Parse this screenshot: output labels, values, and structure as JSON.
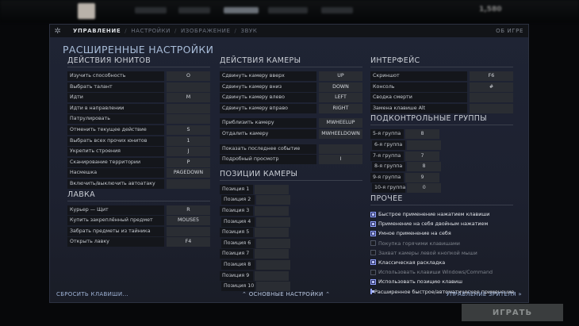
{
  "top": {
    "gold": "1,580"
  },
  "nav": {
    "items": [
      "УПРАВЛЕНИЕ",
      "НАСТРОЙКИ",
      "ИЗОБРАЖЕНИЕ",
      "ЗВУК"
    ],
    "about": "ОБ ИГРЕ"
  },
  "title": "РАСШИРЕННЫЕ НАСТРОЙКИ",
  "unit_actions": {
    "heading": "ДЕЙСТВИЯ ЮНИТОВ",
    "rows": [
      {
        "label": "Изучить способность",
        "key": "O"
      },
      {
        "label": "Выбрать талант",
        "key": ""
      },
      {
        "label": "Идти",
        "key": "M"
      },
      {
        "label": "Идти в направлении",
        "key": ""
      },
      {
        "label": "Патрулировать",
        "key": ""
      },
      {
        "label": "Отменить текущее действие",
        "key": "S"
      },
      {
        "label": "Выбрать всех прочих юнитов",
        "key": "1"
      },
      {
        "label": "Укрепить строения",
        "key": "J"
      },
      {
        "label": "Сканирование территории",
        "key": "P"
      },
      {
        "label": "Насмешка",
        "key": "PAGEDOWN"
      },
      {
        "label": "Включить/выключить автоатаку",
        "key": ""
      }
    ]
  },
  "shop": {
    "heading": "ЛАВКА",
    "rows": [
      {
        "label": "Курьер — Щит",
        "key": "R"
      },
      {
        "label": "Купить закреплённый предмет",
        "key": "MOUSE5"
      },
      {
        "label": "Забрать предметы из тайника",
        "key": ""
      },
      {
        "label": "Открыть лавку",
        "key": "F4"
      }
    ]
  },
  "camera_actions": {
    "heading": "ДЕЙСТВИЯ КАМЕРЫ",
    "groups": [
      [
        {
          "label": "Сдвинуть камеру вверх",
          "key": "UP"
        },
        {
          "label": "Сдвинуть камеру вниз",
          "key": "DOWN"
        },
        {
          "label": "Сдвинуть камеру влево",
          "key": "LEFT"
        },
        {
          "label": "Сдвинуть камеру вправо",
          "key": "RIGHT"
        }
      ],
      [
        {
          "label": "Приблизить камеру",
          "key": "MWHEELUP"
        },
        {
          "label": "Отдалить камеру",
          "key": "MWHEELDOWN"
        }
      ],
      [
        {
          "label": "Показать последнее событие",
          "key": ""
        },
        {
          "label": "Подробный просмотр",
          "key": "I"
        }
      ]
    ]
  },
  "camera_positions": {
    "heading": "ПОЗИЦИИ КАМЕРЫ",
    "items": [
      {
        "label": "Позиция 1",
        "key": ""
      },
      {
        "label": "Позиция 2",
        "key": ""
      },
      {
        "label": "Позиция 3",
        "key": ""
      },
      {
        "label": "Позиция 4",
        "key": ""
      },
      {
        "label": "Позиция 5",
        "key": ""
      },
      {
        "label": "Позиция 6",
        "key": ""
      },
      {
        "label": "Позиция 7",
        "key": ""
      },
      {
        "label": "Позиция 8",
        "key": ""
      },
      {
        "label": "Позиция 9",
        "key": ""
      },
      {
        "label": "Позиция 10",
        "key": ""
      }
    ]
  },
  "interface": {
    "heading": "ИНТЕРФЕЙС",
    "rows": [
      {
        "label": "Скриншот",
        "key": "F6"
      },
      {
        "label": "Консоль",
        "key": "#"
      },
      {
        "label": "Сводка смерти",
        "key": ""
      },
      {
        "label": "Замена клавише Alt",
        "key": ""
      }
    ]
  },
  "control_groups": {
    "heading": "ПОДКОНТРОЛЬНЫЕ ГРУППЫ",
    "items": [
      {
        "label": "5-я группа",
        "key": "8"
      },
      {
        "label": "6-я группа",
        "key": ""
      },
      {
        "label": "7-я группа",
        "key": "7"
      },
      {
        "label": "8-я группа",
        "key": "8"
      },
      {
        "label": "9-я группа",
        "key": "9"
      },
      {
        "label": "10-я группа",
        "key": "0"
      }
    ]
  },
  "other": {
    "heading": "ПРОЧЕЕ",
    "options": [
      {
        "label": "Быстрое применение нажатием клавиши",
        "checked": true
      },
      {
        "label": "Применение на себя двойным нажатием",
        "checked": true
      },
      {
        "label": "Умное применение на себя",
        "checked": true
      },
      {
        "label": "Покупка горячими клавишами",
        "checked": false
      },
      {
        "label": "Захват камеры левой кнопкой мыши",
        "checked": false
      },
      {
        "label": "Классическая раскладка",
        "checked": true
      },
      {
        "label": "Использовать клавиши Windows/Command",
        "checked": false
      },
      {
        "label": "Использовать позицию клавиш",
        "checked": true
      },
      {
        "label": "Расширенное быстрое/автоматическое применение",
        "checked": true
      }
    ]
  },
  "footer": {
    "reset": "СБРОСИТЬ КЛАВИШИ...",
    "basic": "⌃ ОСНОВНЫЕ НАСТРОЙКИ ⌃",
    "spectator": "УПРАВЛЕНИЕ ЗРИТЕЛЯ »"
  },
  "play": "ИГРАТЬ",
  "colors": {
    "accent": "#a8bcd8",
    "checkbox_on": "#8fa0ff",
    "panel": "#1f2434"
  }
}
